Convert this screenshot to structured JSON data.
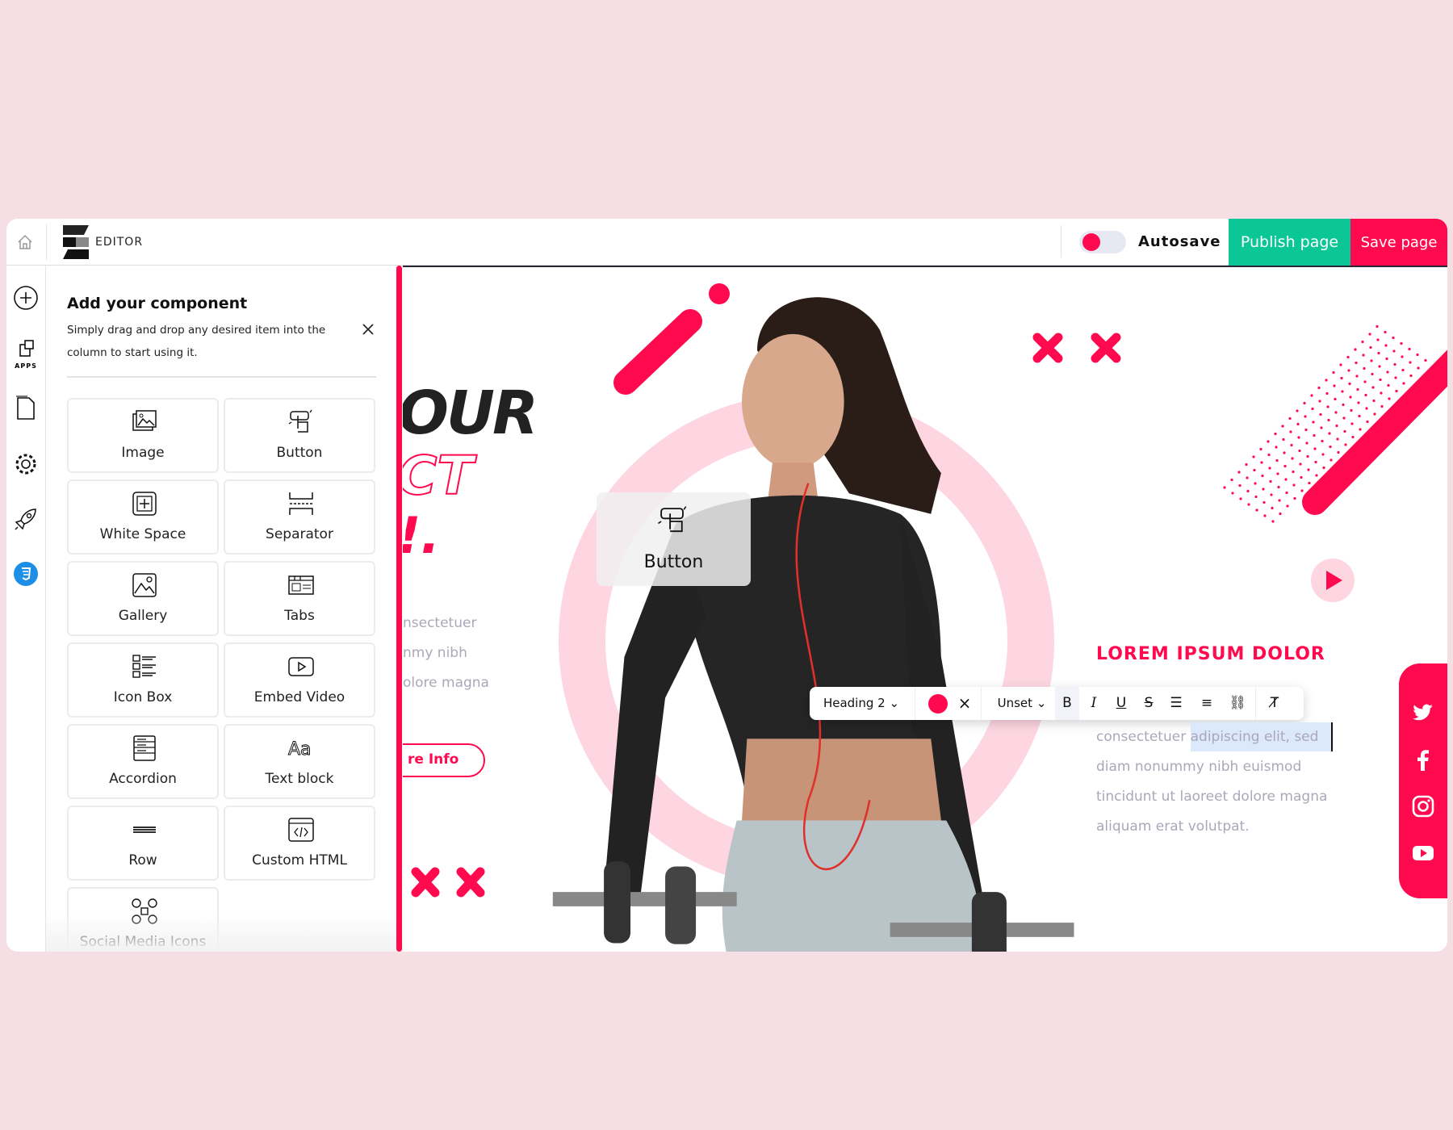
{
  "header": {
    "brand": "EDITOR",
    "autosave_label": "Autosave",
    "autosave_on": true,
    "publish_label": "Publish page",
    "save_label": "Save page"
  },
  "rail": {
    "items": [
      {
        "icon": "plus-circle-icon"
      },
      {
        "icon": "apps-icon",
        "label": "APPS"
      },
      {
        "icon": "pages-icon"
      },
      {
        "icon": "gear-icon"
      },
      {
        "icon": "rocket-icon"
      },
      {
        "icon": "css3-icon"
      }
    ]
  },
  "panel": {
    "title": "Add your component",
    "subtitle": "Simply drag and drop any desired item into the column to start using it.",
    "components": [
      {
        "label": "Image",
        "icon": "image-icon"
      },
      {
        "label": "Button",
        "icon": "button-click-icon"
      },
      {
        "label": "White Space",
        "icon": "white-space-icon"
      },
      {
        "label": "Separator",
        "icon": "separator-icon"
      },
      {
        "label": "Gallery",
        "icon": "gallery-icon"
      },
      {
        "label": "Tabs",
        "icon": "tabs-icon"
      },
      {
        "label": "Icon Box",
        "icon": "icon-box-icon"
      },
      {
        "label": "Embed Video",
        "icon": "video-icon"
      },
      {
        "label": "Accordion",
        "icon": "accordion-icon"
      },
      {
        "label": "Text block",
        "icon": "text-block-icon"
      },
      {
        "label": "Row",
        "icon": "row-icon"
      },
      {
        "label": "Custom HTML",
        "icon": "code-icon"
      },
      {
        "label": "Social Media Icons",
        "icon": "social-icon"
      }
    ]
  },
  "canvas": {
    "hero_line1": "OUR",
    "hero_line2": "CT",
    "hero_line3": "!.",
    "left_lines": [
      "nsectetuer",
      "nmy nibh",
      "olore magna"
    ],
    "more_info": "re Info",
    "drag_ghost": "Button",
    "heading": "LOREM IPSUM DOLOR",
    "paragraph": {
      "line1_plain": "consectetuer ",
      "line1_selected": "adipiscing elit, sed",
      "lines": [
        "diam nonummy nibh euismod",
        "tincidunt ut laoreet dolore magna",
        "aliquam erat volutpat."
      ]
    },
    "toolbar": {
      "block": "Heading 2",
      "color": "#ff0a4e",
      "font_size": "Unset",
      "bold": "B",
      "italic": "I",
      "underline": "U",
      "strike": "S"
    },
    "social": [
      "twitter-icon",
      "facebook-icon",
      "instagram-icon",
      "youtube-icon"
    ]
  },
  "colors": {
    "accent": "#ff0a4e",
    "publish": "#0bc795",
    "background": "#f5dfe4",
    "ring": "#fdd6e1"
  }
}
